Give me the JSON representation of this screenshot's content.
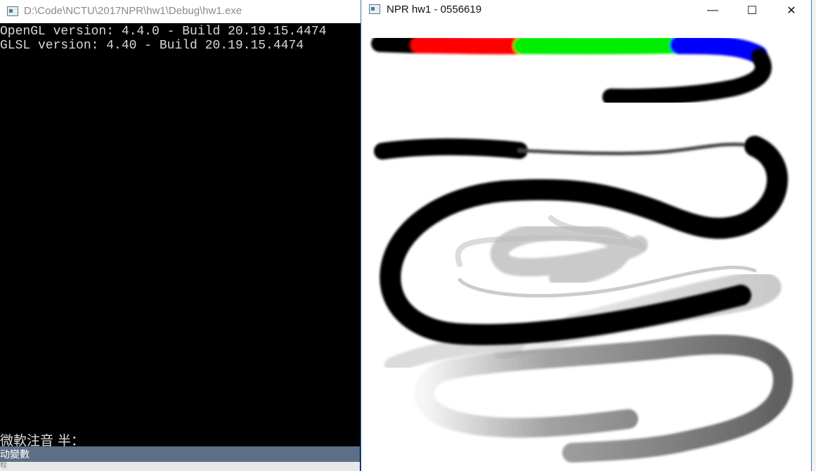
{
  "console": {
    "title": "D:\\Code\\NCTU\\2017NPR\\hw1\\Debug\\hw1.exe",
    "lines": [
      "OpenGL version: 4.4.0 - Build 20.19.15.4474",
      "GLSL version: 4.40 - Build 20.19.15.4474"
    ],
    "ime_status": "微軟注音 半：",
    "status_bar": "动變數",
    "bottom_text": "程"
  },
  "npr_window": {
    "title": "NPR hw1 - 0556619",
    "icons": {
      "minimize": "minimize-icon",
      "maximize": "maximize-icon",
      "close": "close-icon"
    },
    "glyphs": {
      "minimize": "—",
      "maximize": "☐",
      "close": "✕"
    }
  },
  "colors": {
    "stroke_black": "#000000",
    "stroke_red": "#ff0000",
    "stroke_green": "#00ee00",
    "stroke_blue": "#0000ff",
    "stroke_gray": "#555555",
    "stroke_light_gray": "#9a9a9a"
  }
}
